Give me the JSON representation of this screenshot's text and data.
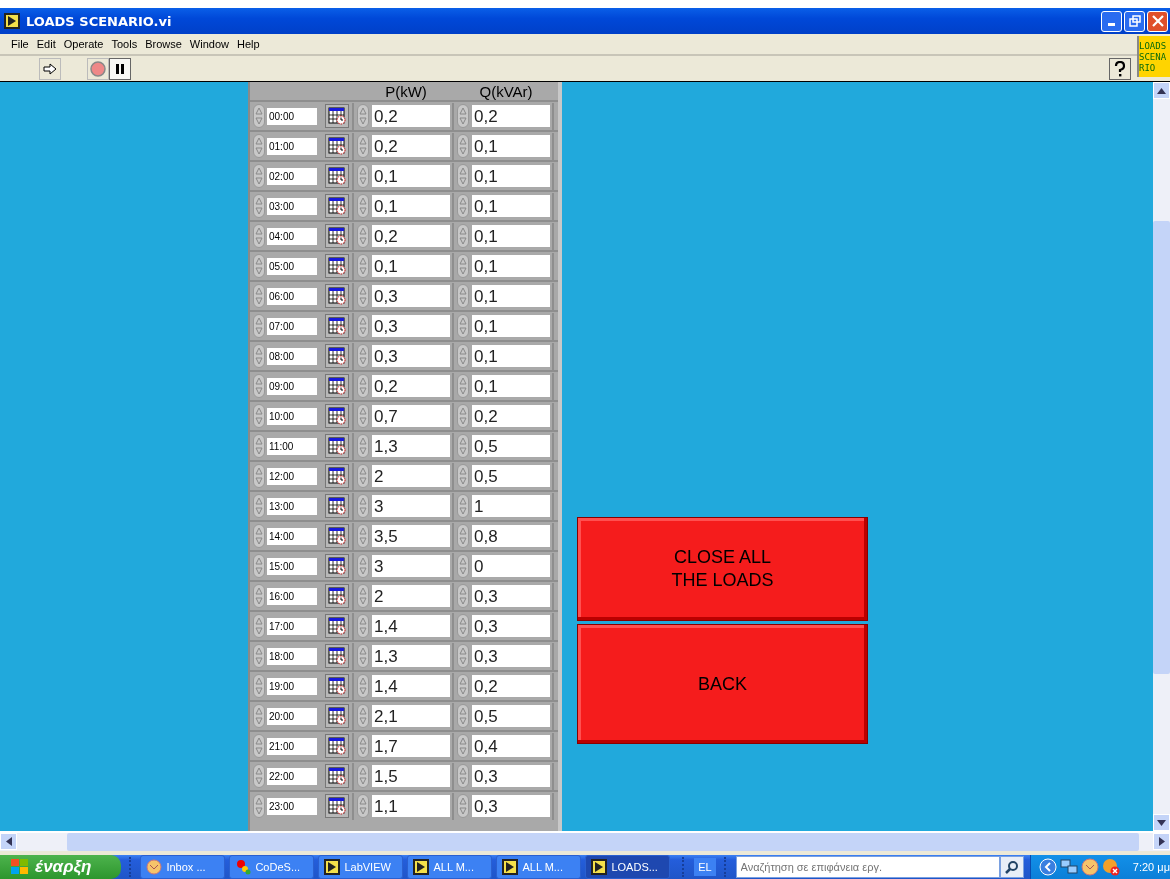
{
  "window": {
    "title": "LOADS SCENARIO.vi"
  },
  "menu": [
    "File",
    "Edit",
    "Operate",
    "Tools",
    "Browse",
    "Window",
    "Help"
  ],
  "corner_label": "LOADS SCENARIO",
  "table": {
    "columns": [
      "P(kW)",
      "Q(kVAr)"
    ],
    "rows": [
      {
        "time": "00:00",
        "p": "0,2",
        "q": "0,2"
      },
      {
        "time": "01:00",
        "p": "0,2",
        "q": "0,1"
      },
      {
        "time": "02:00",
        "p": "0,1",
        "q": "0,1"
      },
      {
        "time": "03:00",
        "p": "0,1",
        "q": "0,1"
      },
      {
        "time": "04:00",
        "p": "0,2",
        "q": "0,1"
      },
      {
        "time": "05:00",
        "p": "0,1",
        "q": "0,1"
      },
      {
        "time": "06:00",
        "p": "0,3",
        "q": "0,1"
      },
      {
        "time": "07:00",
        "p": "0,3",
        "q": "0,1"
      },
      {
        "time": "08:00",
        "p": "0,3",
        "q": "0,1"
      },
      {
        "time": "09:00",
        "p": "0,2",
        "q": "0,1"
      },
      {
        "time": "10:00",
        "p": "0,7",
        "q": "0,2"
      },
      {
        "time": "11:00",
        "p": "1,3",
        "q": "0,5"
      },
      {
        "time": "12:00",
        "p": "2",
        "q": "0,5"
      },
      {
        "time": "13:00",
        "p": "3",
        "q": "1"
      },
      {
        "time": "14:00",
        "p": "3,5",
        "q": "0,8"
      },
      {
        "time": "15:00",
        "p": "3",
        "q": "0"
      },
      {
        "time": "16:00",
        "p": "2",
        "q": "0,3"
      },
      {
        "time": "17:00",
        "p": "1,4",
        "q": "0,3"
      },
      {
        "time": "18:00",
        "p": "1,3",
        "q": "0,3"
      },
      {
        "time": "19:00",
        "p": "1,4",
        "q": "0,2"
      },
      {
        "time": "20:00",
        "p": "2,1",
        "q": "0,5"
      },
      {
        "time": "21:00",
        "p": "1,7",
        "q": "0,4"
      },
      {
        "time": "22:00",
        "p": "1,5",
        "q": "0,3"
      },
      {
        "time": "23:00",
        "p": "1,1",
        "q": "0,3"
      }
    ]
  },
  "buttons": [
    {
      "label": "CLOSE ALL\nTHE LOADS",
      "kind": "close"
    },
    {
      "label": "BACK",
      "kind": "back"
    }
  ],
  "taskbar": {
    "start": "έναρξη",
    "tasks": [
      {
        "label": "Inbox ...",
        "kind": "mail",
        "selected": false
      },
      {
        "label": "CoDeS...",
        "kind": "dots",
        "selected": false
      },
      {
        "label": "LabVIEW",
        "kind": "vi",
        "selected": false
      },
      {
        "label": "ALL M...",
        "kind": "vi",
        "selected": false
      },
      {
        "label": "ALL M...",
        "kind": "vi",
        "selected": false
      },
      {
        "label": "LOADS...",
        "kind": "vi",
        "selected": true
      }
    ],
    "language": "EL",
    "search_placeholder": "Αναζήτηση σε επιφάνεια εργ.",
    "clock": "7:20 μμ"
  }
}
